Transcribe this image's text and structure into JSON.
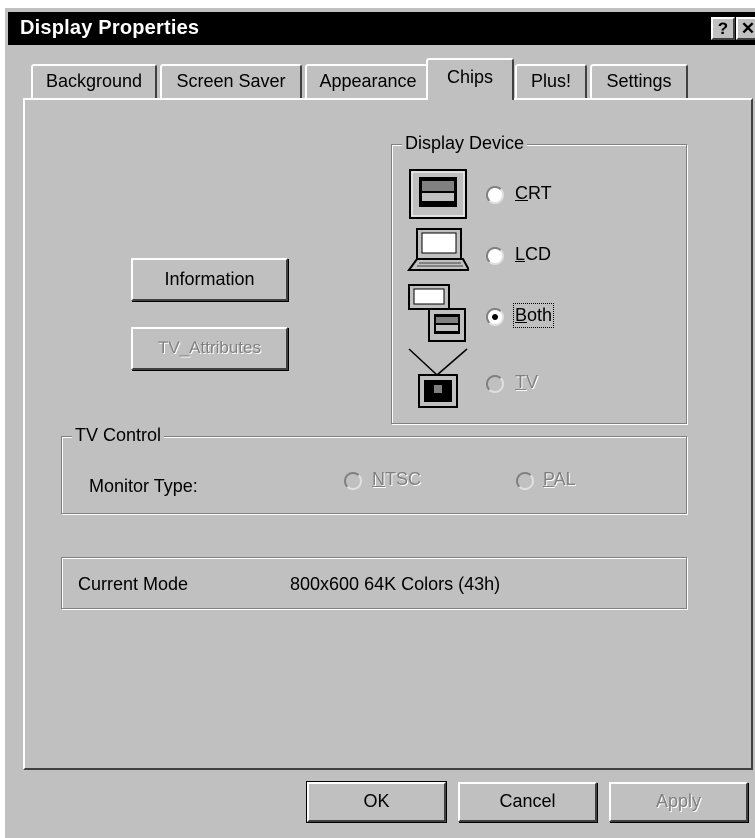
{
  "window": {
    "title": "Display Properties",
    "help_glyph": "?",
    "close_glyph": "✕"
  },
  "tabs": [
    {
      "label": "Background",
      "active": false
    },
    {
      "label": "Screen Saver",
      "active": false
    },
    {
      "label": "Appearance",
      "active": false
    },
    {
      "label": "Chips",
      "active": true
    },
    {
      "label": "Plus!",
      "active": false
    },
    {
      "label": "Settings",
      "active": false
    }
  ],
  "buttons": {
    "information": "Information",
    "tv_attributes": "TV_Attributes"
  },
  "display_device": {
    "group_label": "Display Device",
    "options": [
      {
        "label": "CRT",
        "accel": "C",
        "rest": "RT",
        "icon": "crt-monitor-icon",
        "selected": false,
        "enabled": true
      },
      {
        "label": "LCD",
        "accel": "L",
        "rest": "CD",
        "icon": "lcd-laptop-icon",
        "selected": false,
        "enabled": true
      },
      {
        "label": "Both",
        "accel": "B",
        "rest": "oth",
        "icon": "crt-and-lcd-icon",
        "selected": true,
        "enabled": true
      },
      {
        "label": "TV",
        "accel": "T",
        "rest": "V",
        "icon": "tv-icon",
        "selected": false,
        "enabled": false
      }
    ]
  },
  "tv_control": {
    "group_label": "TV Control",
    "monitor_type_label": "Monitor Type:",
    "options": [
      {
        "label": "NTSC",
        "accel": "N",
        "rest": "TSC",
        "selected": false,
        "enabled": false
      },
      {
        "label": "PAL",
        "accel": "P",
        "rest": "AL",
        "selected": false,
        "enabled": false
      }
    ]
  },
  "current_mode": {
    "label": "Current Mode",
    "value": "800x600 64K Colors (43h)"
  },
  "footer": {
    "ok": "OK",
    "cancel": "Cancel",
    "apply": "Apply",
    "apply_enabled": false
  }
}
